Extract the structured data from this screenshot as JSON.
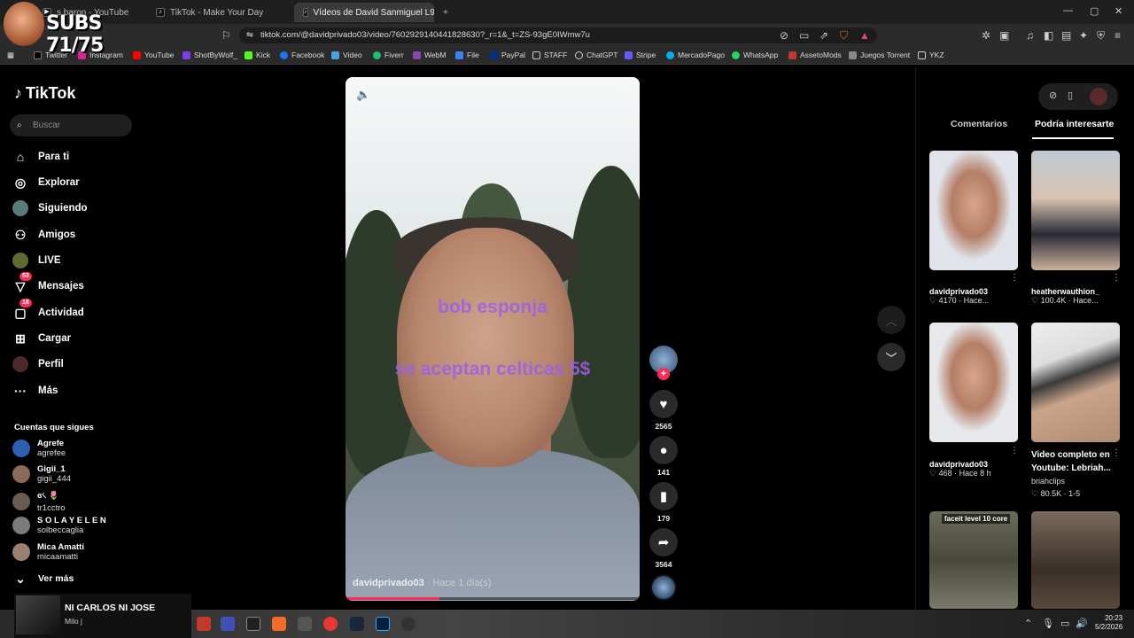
{
  "browser": {
    "tabs": [
      {
        "label": "s baron - YouTube"
      },
      {
        "label": "TikTok - Make Your Day"
      },
      {
        "label": "Vídeos de David Sanmiguel L95"
      }
    ],
    "url": "tiktok.com/@davidprivado03/video/7602929140441828630?_r=1&_t=ZS-93gE0IWmw7u",
    "bookmarks": [
      "Twitter",
      "Instagram",
      "YouTube",
      "ShotByWolf_",
      "Kick",
      "Facebook",
      "Video",
      "Fiverr",
      "WebM",
      "File",
      "PayPal",
      "STAFF",
      "ChatGPT",
      "Stripe",
      "MercadoPago",
      "WhatsApp",
      "AssetoMods",
      "Juegos Torrent",
      "YKZ"
    ]
  },
  "stream_overlay": {
    "subs": "SUBS 71/75"
  },
  "sidebar": {
    "logo": "TikTok",
    "search_placeholder": "Buscar",
    "nav": [
      {
        "label": "Para ti",
        "icon": "home-icon"
      },
      {
        "label": "Explorar",
        "icon": "compass-icon"
      },
      {
        "label": "Siguiendo",
        "icon": "following-icon"
      },
      {
        "label": "Amigos",
        "icon": "friends-icon"
      },
      {
        "label": "LIVE",
        "icon": "live-icon"
      },
      {
        "label": "Mensajes",
        "icon": "messages-icon",
        "badge": "53"
      },
      {
        "label": "Actividad",
        "icon": "activity-icon",
        "badge": "18"
      },
      {
        "label": "Cargar",
        "icon": "upload-icon"
      },
      {
        "label": "Perfil",
        "icon": "profile-icon"
      },
      {
        "label": "Más",
        "icon": "more-icon"
      }
    ],
    "following_title": "Cuentas que sigues",
    "following": [
      {
        "name": "Agrefe",
        "handle": "agrefee"
      },
      {
        "name": "Gigii_1",
        "handle": "gigii_444"
      },
      {
        "name": "ɞ৻ 🌷",
        "handle": "tr1cctro"
      },
      {
        "name": "S O L A Y E L E N",
        "handle": "solbeccaglia"
      },
      {
        "name": "Mica Amatti",
        "handle": "micaamatti"
      }
    ],
    "see_more": "Ver más"
  },
  "video": {
    "overlay_text_1": "bob esponja",
    "overlay_text_2": "se aceptan celticas 5$",
    "author": "davidprivado03",
    "time": "· Hace 1 día(s)",
    "progress": 0.32
  },
  "actions": {
    "likes": "2565",
    "comments": "141",
    "saves": "179",
    "shares": "3564"
  },
  "right_panel": {
    "tabs": [
      "Comentarios",
      "Podría interesarte"
    ],
    "items": [
      {
        "title": "davidprivado03",
        "stats": "♡ 4170 · Hace..."
      },
      {
        "title": "heatherwauthion_",
        "stats": "♡ 100.4K · Hace..."
      },
      {
        "title": "davidprivado03",
        "stats": "♡ 468 · Hace 8 h"
      },
      {
        "title": "Video completo en Youtube: Lebriah...",
        "author": "briahclips",
        "stats": "♡ 80.5K · 1-5"
      },
      {
        "title": "faceit level 10 core",
        "stats": ""
      },
      {
        "title": "",
        "stats": ""
      }
    ]
  },
  "now_playing": {
    "title": "NI CARLOS NI JOSE",
    "artist": "Milo j"
  },
  "clock": {
    "time": "20:23",
    "date": "5/2/2026"
  }
}
